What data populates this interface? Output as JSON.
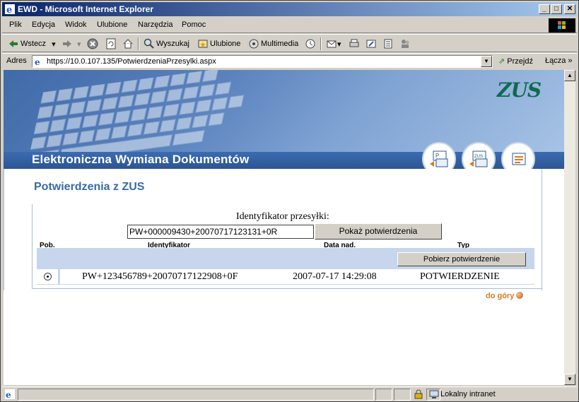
{
  "window": {
    "title": "EWD - Microsoft Internet Explorer",
    "min": "_",
    "max": "□",
    "close": "✕"
  },
  "menu": [
    "Plik",
    "Edycja",
    "Widok",
    "Ulubione",
    "Narzędzia",
    "Pomoc"
  ],
  "toolbar": {
    "back": "Wstecz",
    "search": "Wyszukaj",
    "favorites": "Ulubione",
    "media": "Multimedia"
  },
  "address": {
    "label": "Adres",
    "url": "https://10.0.107.135/PotwierdzeniaPrzesylki.aspx",
    "go": "Przejdź",
    "links": "Łącza"
  },
  "banner": {
    "title": "Elektroniczna Wymiana Dokumentów",
    "logo": "ZUS"
  },
  "page": {
    "title": "Potwierdzenia z ZUS",
    "ident_label": "Identyfikator przesyłki:",
    "ident_value": "PW+000009430+20070717123131+0R",
    "show_button": "Pokaż potwierdzenia",
    "columns": {
      "pob": "Pob.",
      "id": "Identyfikator",
      "date": "Data nad.",
      "type": "Typ"
    },
    "get_button": "Pobierz potwierdzenie",
    "rows": [
      {
        "id": "PW+123456789+20070717122908+0F",
        "date": "2007-07-17 14:29:08",
        "type": "POTWIERDZENIE"
      }
    ],
    "to_top": "do góry"
  },
  "status": {
    "zone": "Lokalny intranet"
  },
  "colors": {
    "titlebar": "#0a246a",
    "accent": "#3b6aa6",
    "logo": "#0d6b4f",
    "link": "#e07820"
  }
}
